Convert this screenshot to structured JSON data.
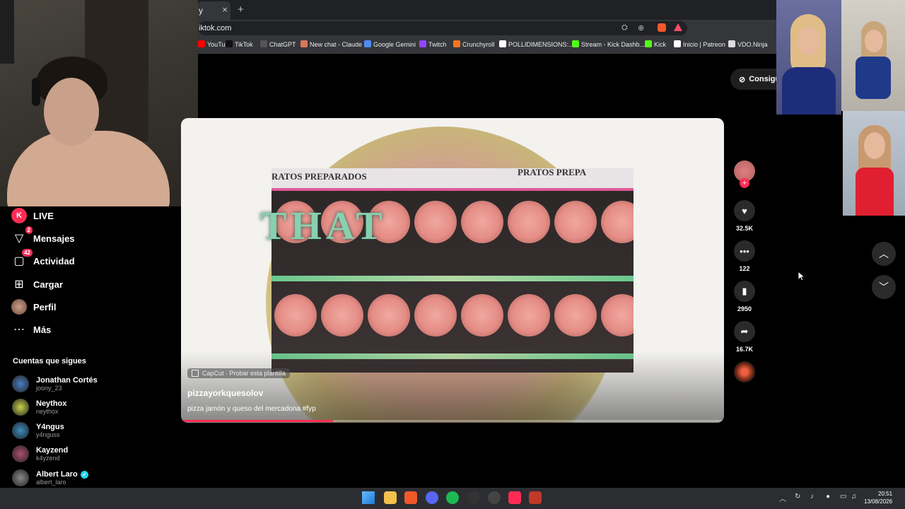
{
  "browser": {
    "tab_label": "y",
    "tab_close": "×",
    "new_tab": "+",
    "url": "iktok.com",
    "bookmarks": [
      {
        "label": "YouTube",
        "color": "#ff0000"
      },
      {
        "label": "TikTok",
        "color": "#111111"
      },
      {
        "label": "ChatGPT",
        "color": "#555555"
      },
      {
        "label": "New chat - Claude",
        "color": "#d97757"
      },
      {
        "label": "Google Gemini",
        "color": "#4f8bf5"
      },
      {
        "label": "Twitch",
        "color": "#9146ff"
      },
      {
        "label": "Crunchyroll",
        "color": "#f47521"
      },
      {
        "label": "POLLIDIMENSIONS:...",
        "color": "#ffffff"
      },
      {
        "label": "Stream - Kick Dashb...",
        "color": "#53fc18"
      },
      {
        "label": "Kick",
        "color": "#53fc18"
      },
      {
        "label": "Inicio | Patreon",
        "color": "#ffffff"
      },
      {
        "label": "VDO.Ninja",
        "color": "#dddddd"
      }
    ]
  },
  "sidebar": {
    "items": [
      {
        "label": "LIVE",
        "icon": "live-icon"
      },
      {
        "label": "Mensajes",
        "icon": "messages-icon",
        "badge": "2"
      },
      {
        "label": "Actividad",
        "icon": "activity-icon",
        "badge": "42"
      },
      {
        "label": "Cargar",
        "icon": "upload-icon"
      },
      {
        "label": "Perfil",
        "icon": "profile-avatar"
      },
      {
        "label": "Más",
        "icon": "more-icon"
      }
    ],
    "following_title": "Cuentas que sigues",
    "following": [
      {
        "name": "Jonathan Cortés",
        "handle": "joony_23",
        "color": "#4a7fc4"
      },
      {
        "name": "Neythox",
        "handle": "neythox",
        "color": "#c9d24a"
      },
      {
        "name": "Y4ngus",
        "handle": "y4nguss",
        "color": "#3b8cc2"
      },
      {
        "name": "Kayzend",
        "handle": "k4yzend",
        "color": "#b05070"
      },
      {
        "name": "Albert Laro",
        "handle": "albert_laro",
        "color": "#888888"
      }
    ]
  },
  "video": {
    "shelf_label_left": "RATOS PREPARADOS",
    "shelf_label_right": "PRATOS PREPA",
    "overlay_text": "THAT",
    "capcut_label": "CapCut · Probar esta plantilla",
    "author": "pizzayorkquesolov",
    "description": "pizza jamón y queso del mercadona #fyp",
    "progress": 0.28
  },
  "actions": {
    "likes": "32.5K",
    "comments": "122",
    "saves": "2950",
    "shares": "16.7K"
  },
  "get_coins_label": "Consigu",
  "taskbar": {
    "time": "20:51",
    "date": "13/08/2026"
  }
}
